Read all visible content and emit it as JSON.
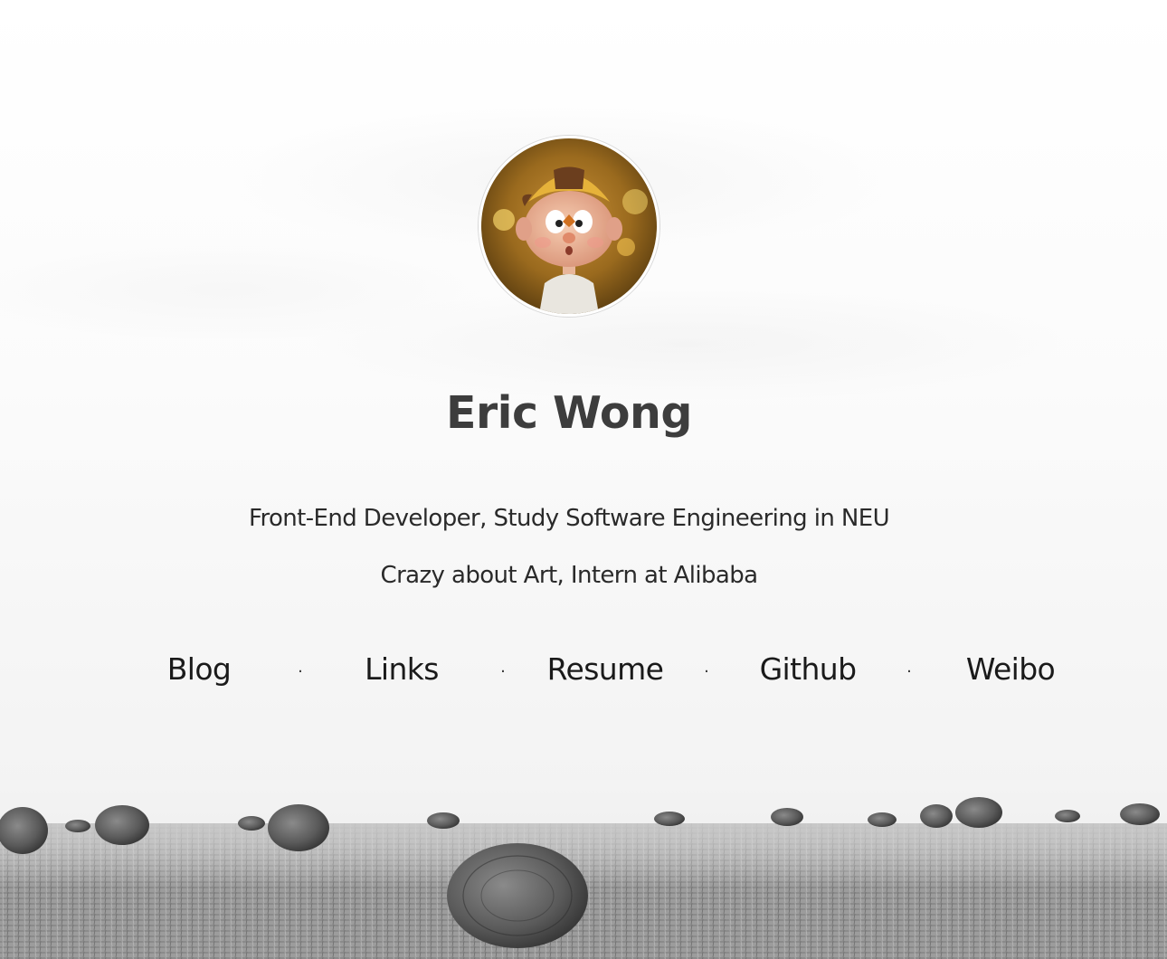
{
  "profile": {
    "name": "Eric Wong",
    "avatar_alt": "cartoon boy avatar",
    "tagline_line1": "Front-End Developer, Study Software Engineering in NEU",
    "tagline_line2": "Crazy about Art, Intern at Alibaba"
  },
  "nav": {
    "separator": "·",
    "links": [
      {
        "label": "Blog"
      },
      {
        "label": "Links"
      },
      {
        "label": "Resume"
      },
      {
        "label": "Github"
      },
      {
        "label": "Weibo"
      }
    ]
  },
  "colors": {
    "name_text": "#3d3d3d",
    "body_text": "#1a1a1a",
    "avatar_cap": "#e6b23a",
    "avatar_bg": "#9a6a1e"
  }
}
